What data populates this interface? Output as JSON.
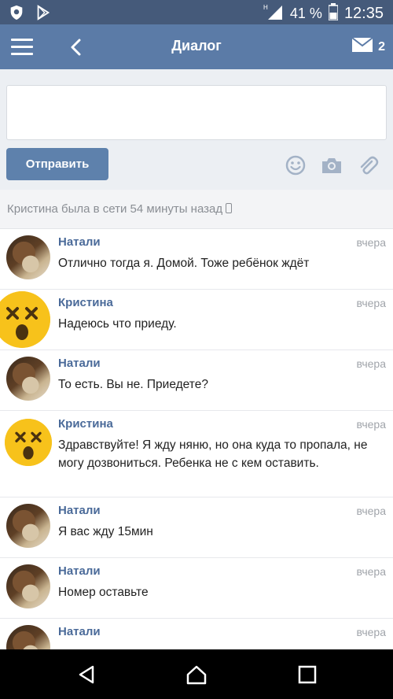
{
  "status_bar": {
    "battery_percent": "41 %",
    "time": "12:35",
    "icons": [
      "shield-icon",
      "play-store-icon",
      "signal-icon",
      "battery-icon"
    ]
  },
  "header": {
    "title": "Диалог",
    "unread_count": "2",
    "icons": [
      "menu-icon",
      "back-icon",
      "mail-icon"
    ]
  },
  "compose": {
    "input_value": "",
    "send_label": "Отправить",
    "tools": [
      "emoji-icon",
      "camera-icon",
      "attach-icon"
    ]
  },
  "online_status": "Кристина была в сети 54 минуты назад",
  "messages": [
    {
      "author": "Натали",
      "time": "вчера",
      "text": "Отлично тогда я. Домой. Тоже ребёнок ждёт",
      "avatar": "photo"
    },
    {
      "author": "Кристина",
      "time": "вчера",
      "text": "Надеюсь что приеду.",
      "avatar": "emoji"
    },
    {
      "author": "Натали",
      "time": "вчера",
      "text": "То есть. Вы не. Приедете?",
      "avatar": "photo"
    },
    {
      "author": "Кристина",
      "time": "вчера",
      "text": "Здравствуйте! Я жду няню, но она куда то пропала, не могу дозвониться. Ребенка не с кем оставить.",
      "avatar": "emoji"
    },
    {
      "author": "Натали",
      "time": "вчера",
      "text": "Я вас жду 15мин",
      "avatar": "photo"
    },
    {
      "author": "Натали",
      "time": "вчера",
      "text": "Номер оставьте",
      "avatar": "photo"
    },
    {
      "author": "Натали",
      "time": "вчера",
      "text": "",
      "avatar": "photo"
    }
  ],
  "colors": {
    "header": "#5b7ba7",
    "status_bar": "#455a7a",
    "accent_name": "#4a6a99",
    "send_button": "#5e81ac",
    "emoji_yellow": "#f7c21b"
  }
}
